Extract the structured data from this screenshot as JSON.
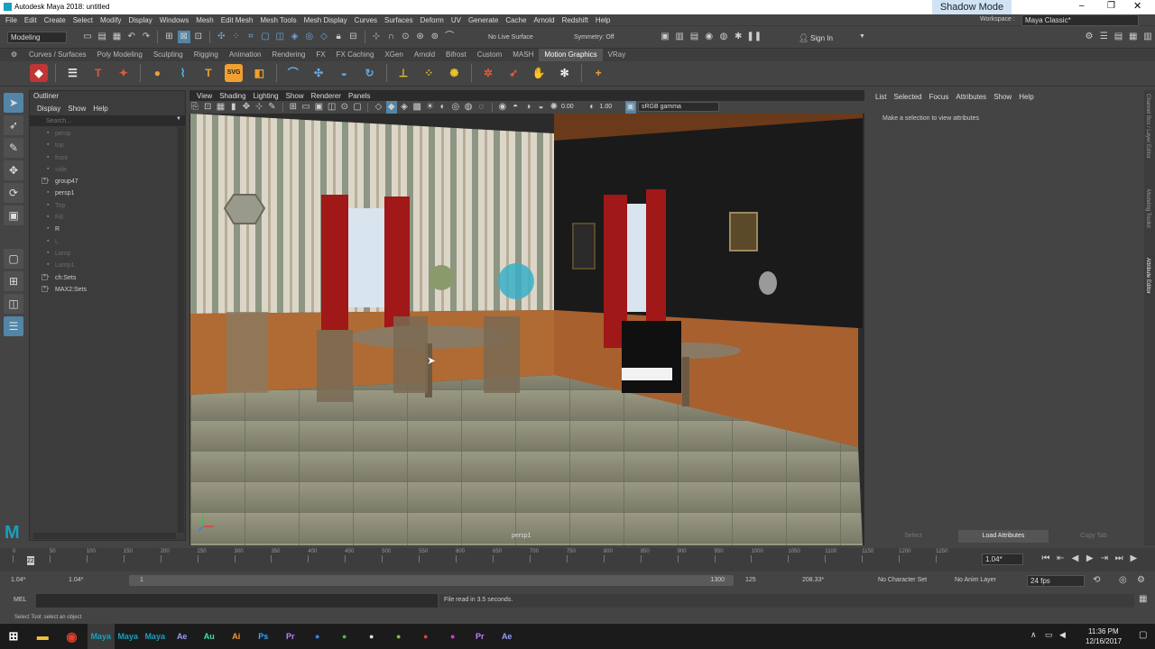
{
  "app": {
    "title": "Autodesk Maya 2018: untitled",
    "overlay_title": "Shadow Mode",
    "workspace_label": "Workspace :",
    "workspace_value": "Maya Classic*"
  },
  "menus": [
    "File",
    "Edit",
    "Create",
    "Select",
    "Modify",
    "Display",
    "Windows",
    "Mesh",
    "Edit Mesh",
    "Mesh Tools",
    "Mesh Display",
    "Curves",
    "Surfaces",
    "Deform",
    "UV",
    "Generate",
    "Cache",
    "Arnold",
    "Redshift",
    "Help"
  ],
  "status": {
    "mode": "Modeling",
    "live_surface": "No Live Surface",
    "symmetry": "Symmetry: Off",
    "sign_in": "Sign In"
  },
  "shelf_tabs": [
    "Curves / Surfaces",
    "Poly Modeling",
    "Sculpting",
    "Rigging",
    "Animation",
    "Rendering",
    "FX",
    "FX Caching",
    "XGen",
    "Arnold",
    "Bifrost",
    "Custom",
    "MASH",
    "Motion Graphics",
    "VRay"
  ],
  "shelf_active": "Motion Graphics",
  "outliner": {
    "title": "Outliner",
    "menus": [
      "Display",
      "Show",
      "Help"
    ],
    "search_placeholder": "Search...",
    "items": [
      {
        "label": "persp",
        "dim": true,
        "expand": false
      },
      {
        "label": "top",
        "dim": true,
        "expand": false
      },
      {
        "label": "front",
        "dim": true,
        "expand": false
      },
      {
        "label": "side",
        "dim": true,
        "expand": false
      },
      {
        "label": "group47",
        "dim": false,
        "expand": true
      },
      {
        "label": "persp1",
        "dim": false,
        "expand": false
      },
      {
        "label": "Top",
        "dim": true,
        "expand": false
      },
      {
        "label": "Fill",
        "dim": true,
        "expand": false
      },
      {
        "label": "R",
        "dim": false,
        "expand": false
      },
      {
        "label": "L",
        "dim": true,
        "expand": false
      },
      {
        "label": "Lamp",
        "dim": true,
        "expand": false
      },
      {
        "label": "Lamp1",
        "dim": true,
        "expand": false
      },
      {
        "label": "ch:Sets",
        "dim": false,
        "expand": true
      },
      {
        "label": "MAX2:Sets",
        "dim": false,
        "expand": true
      }
    ]
  },
  "viewport": {
    "menus": [
      "View",
      "Shading",
      "Lighting",
      "Show",
      "Renderer",
      "Panels"
    ],
    "field_a": "0.00",
    "field_b": "1.00",
    "color_space": "sRGB gamma",
    "camera": "persp1"
  },
  "attribute_editor": {
    "menus": [
      "List",
      "Selected",
      "Focus",
      "Attributes",
      "Show",
      "Help"
    ],
    "message": "Make a selection to view attributes",
    "buttons": [
      "Select",
      "Load Attributes",
      "Copy Tab"
    ]
  },
  "side_tabs": [
    "Channel Box / Layer Editor",
    "Modeling Toolkit",
    "Attribute Editor"
  ],
  "timeline": {
    "ticks": [
      "0",
      "50",
      "100",
      "150",
      "200",
      "250",
      "300",
      "350",
      "400",
      "450",
      "500",
      "550",
      "600",
      "650",
      "700",
      "750",
      "800",
      "850",
      "900",
      "950",
      "1000",
      "1050",
      "1100",
      "1150",
      "1200",
      "1250"
    ],
    "current_frame": "22",
    "current_field": "1.04*",
    "range_start": "1.04*",
    "range_start2": "1.04*",
    "range_slider_start": "1",
    "range_slider_end": "1300",
    "end_a": "125",
    "end_b": "208.33*",
    "char_set": "No Character Set",
    "anim_layer": "No Anim Layer",
    "fps": "24 fps"
  },
  "command": {
    "lang": "MEL",
    "result": "File read in  3.5 seconds."
  },
  "help_line": "Select Tool: select an object",
  "taskbar": {
    "apps": [
      "Maya",
      "Maya",
      "Maya",
      "Ae",
      "Au",
      "Ai",
      "Ps",
      "Pr",
      "",
      "",
      "",
      "",
      "",
      "",
      "Pr",
      "Ae"
    ],
    "time": "11:36 PM",
    "date": "12/16/2017"
  }
}
